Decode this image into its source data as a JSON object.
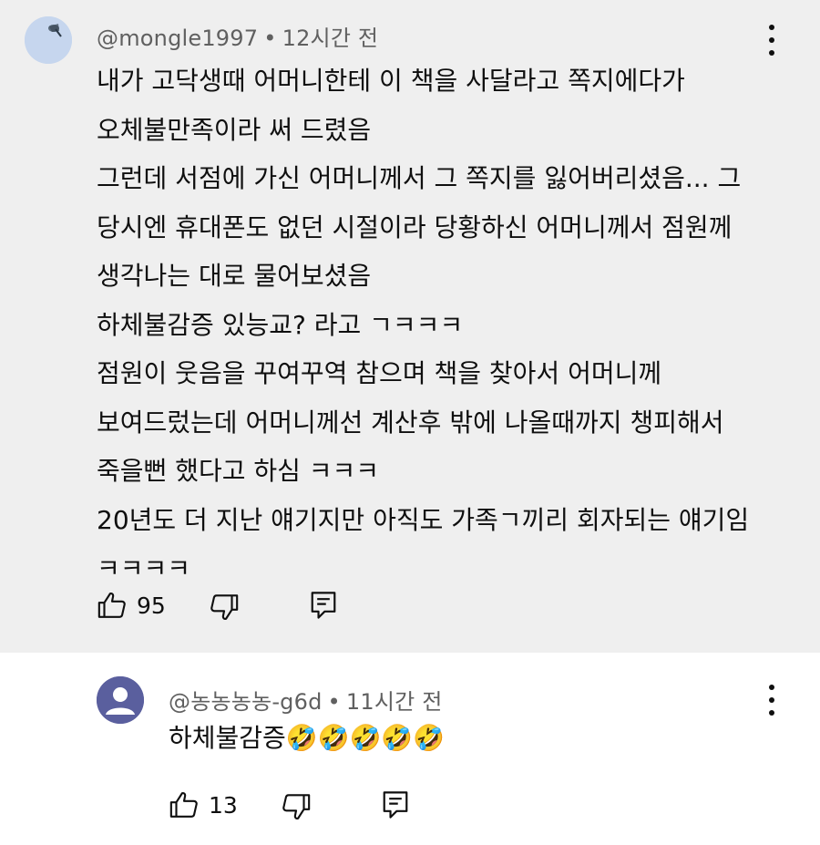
{
  "top_comment": {
    "author": "@mongle1997",
    "separator": "•",
    "time": "12시간 전",
    "lines": [
      "내가 고닥생때 어머니한테 이 책을 사달라고 쪽지에다가",
      "오체불만족이라 써 드렸음",
      "그런데 서점에 가신 어머니께서 그 쪽지를 잃어버리셨음... 그",
      "당시엔 휴대폰도 없던 시절이라 당황하신 어머니께서 점원께",
      "생각나는 대로 물어보셨음",
      "하체불감증 있능교? 라고 ㄱㅋㅋㅋ",
      "점원이 웃음을 꾸여꾸역 참으며 책을 찾아서 어머니께",
      "보여드렀는데 어머니께선 계산후 밖에 나올때까지 챙피해서",
      "죽을뻔 했다고 하심 ㅋㅋㅋ",
      "20년도 더 지난 얘기지만 아직도 가족ㄱ끼리 회자되는 얘기임",
      "ㅋㅋㅋㅋ"
    ],
    "like_count": "95"
  },
  "reply_comment": {
    "author": "@농농농농-g6d",
    "separator": "•",
    "time": "11시간 전",
    "text": "하체불감증🤣🤣🤣🤣🤣",
    "like_count": "13"
  },
  "colors": {
    "top_background": "#efefef",
    "reply_background": "#ffffff",
    "meta_text": "#606060",
    "avatar_reply": "#5a5f9e",
    "avatar_top": "#c6d6ee"
  },
  "icons": [
    "thumbs-up-icon",
    "thumbs-down-icon",
    "reply-icon",
    "more-options-icon",
    "default-avatar-icon"
  ]
}
